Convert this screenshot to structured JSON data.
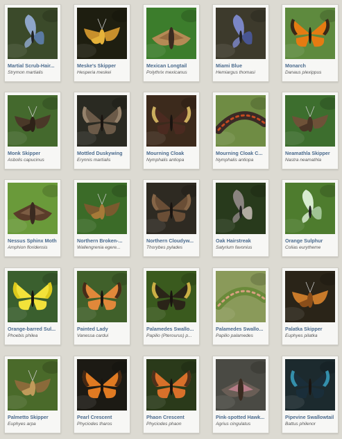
{
  "cards": [
    {
      "name": "Martial Scrub-Hair...",
      "sci": "Strymon martialis",
      "bg": "#3b4a2a",
      "wing": "#8ea6c9",
      "accent": "#5f7fb0",
      "shape": "hair"
    },
    {
      "name": "Meske's Skipper",
      "sci": "Hesperia meskei",
      "bg": "#1e1e10",
      "wing": "#c8902c",
      "accent": "#e5b23a",
      "shape": "skip"
    },
    {
      "name": "Mexican Longtail",
      "sci": "Polythrix mexicanus",
      "bg": "#3c7d2c",
      "wing": "#b58a55",
      "accent": "#8a6038",
      "shape": "moth"
    },
    {
      "name": "Miami Blue",
      "sci": "Hemiargus thomasi",
      "bg": "#3d3a2c",
      "wing": "#7b86c6",
      "accent": "#4a5a9f",
      "shape": "hair"
    },
    {
      "name": "Monarch",
      "sci": "Danaus plexippus",
      "bg": "#5e8a3e",
      "wing": "#e57b12",
      "accent": "#1a1a1a",
      "shape": "open"
    },
    {
      "name": "Monk Skipper",
      "sci": "Asbolis capucinus",
      "bg": "#44692d",
      "wing": "#4a3828",
      "accent": "#2e2218",
      "shape": "skip"
    },
    {
      "name": "Mottled Duskywing",
      "sci": "Erynnis martialis",
      "bg": "#2a2a22",
      "wing": "#6b5a48",
      "accent": "#9c8a72",
      "shape": "open"
    },
    {
      "name": "Mourning Cloak",
      "sci": "Nymphalis antiopa",
      "bg": "#3c2a1c",
      "wing": "#4b2a20",
      "accent": "#e3c56a",
      "shape": "open"
    },
    {
      "name": "Mourning Cloak C...",
      "sci": "Nymphalis antiopa",
      "bg": "#6f8c44",
      "wing": "#3a2a26",
      "accent": "#c44a20",
      "shape": "cat"
    },
    {
      "name": "Neamathla Skipper",
      "sci": "Nastra neamathla",
      "bg": "#3d6e2e",
      "wing": "#6e5238",
      "accent": "#4a3526",
      "shape": "skip"
    },
    {
      "name": "Nessus Sphinx Moth",
      "sci": "Amphion floridensis",
      "bg": "#6a9a3a",
      "wing": "#5a3c2a",
      "accent": "#8a6a4e",
      "shape": "moth"
    },
    {
      "name": "Northern Broken-...",
      "sci": "Wallengrenia egere...",
      "bg": "#3b6b28",
      "wing": "#7a5a2e",
      "accent": "#a67a38",
      "shape": "skip"
    },
    {
      "name": "Northern Cloudyw...",
      "sci": "Thorybes pylades",
      "bg": "#2e2a22",
      "wing": "#6a4e36",
      "accent": "#8a6a4a",
      "shape": "open"
    },
    {
      "name": "Oak Hairstreak",
      "sci": "Satyrium favonius",
      "bg": "#283a1c",
      "wing": "#8a8480",
      "accent": "#c0b8b0",
      "shape": "hair"
    },
    {
      "name": "Orange Sulphur",
      "sci": "Colias eurytheme",
      "bg": "#4e7c2e",
      "wing": "#d8ecd0",
      "accent": "#aacca0",
      "shape": "hair"
    },
    {
      "name": "Orange-barred Sul...",
      "sci": "Phoebis philea",
      "bg": "#3a5f2e",
      "wing": "#f2e23a",
      "accent": "#d8c418",
      "shape": "open"
    },
    {
      "name": "Painted Lady",
      "sci": "Vanessa cardui",
      "bg": "#40602a",
      "wing": "#e0883a",
      "accent": "#2a1c14",
      "shape": "open"
    },
    {
      "name": "Palamedes Swallo...",
      "sci": "Papilio (Pterourus) p...",
      "bg": "#3a5a1e",
      "wing": "#2a2418",
      "accent": "#e6c84e",
      "shape": "open"
    },
    {
      "name": "Palamedes Swallo...",
      "sci": "Papilio palamedes",
      "bg": "#8a9a5a",
      "wing": "#6a8a3a",
      "accent": "#d8a080",
      "shape": "cat"
    },
    {
      "name": "Palatka Skipper",
      "sci": "Euphyes pilatka",
      "bg": "#2a2418",
      "wing": "#c87a2a",
      "accent": "#8a4e1a",
      "shape": "skip"
    },
    {
      "name": "Palmetto Skipper",
      "sci": "Euphyes arpa",
      "bg": "#4a6a2a",
      "wing": "#8a6a3a",
      "accent": "#c09a5a",
      "shape": "skip"
    },
    {
      "name": "Pearl Crescent",
      "sci": "Phyciodes tharos",
      "bg": "#1c1a14",
      "wing": "#e07a22",
      "accent": "#2a1a10",
      "shape": "open"
    },
    {
      "name": "Phaon Crescent",
      "sci": "Phyciodes phaon",
      "bg": "#2a3a1a",
      "wing": "#d8702a",
      "accent": "#3a2418",
      "shape": "open"
    },
    {
      "name": "Pink-spotted Hawk...",
      "sci": "Agrius cingulatus",
      "bg": "#4a4a44",
      "wing": "#6a5e56",
      "accent": "#d88aa0",
      "shape": "moth"
    },
    {
      "name": "Pipevine Swallowtail",
      "sci": "Battus philenor",
      "bg": "#1c2a2e",
      "wing": "#1a2e3a",
      "accent": "#3aa0c0",
      "shape": "open"
    }
  ]
}
